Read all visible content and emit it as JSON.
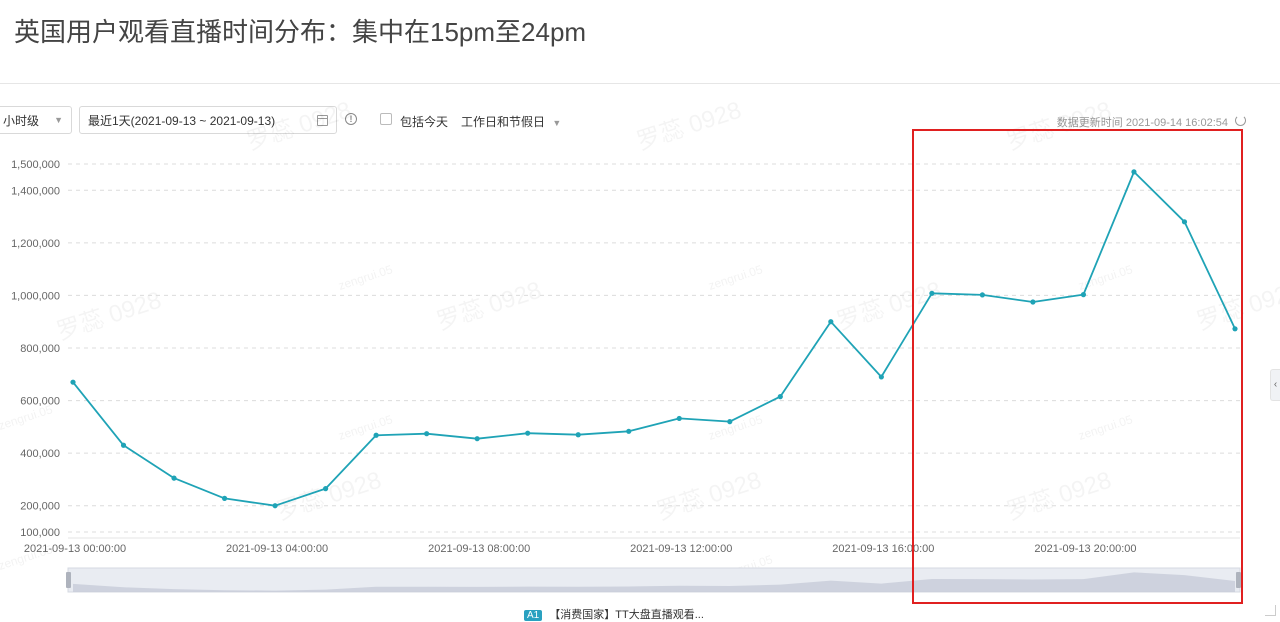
{
  "page": {
    "title": "英国用户观看直播时间分布：集中在15pm至24pm"
  },
  "toolbar": {
    "granularity": "小时级",
    "date_range": "最近1天(2021-09-13 ~ 2021-09-13)",
    "include_today_label": "包括今天",
    "day_type": "工作日和节假日",
    "update_time": "数据更新时间 2021-09-14 16:02:54"
  },
  "footer": {
    "badge": "A1",
    "label": "【消费国家】TT大盘直播观看..."
  },
  "colors": {
    "line": "#1fa3b6",
    "grid": "#dcdcdc",
    "highlight": "#e02020",
    "axis_text": "#666666"
  },
  "chart_data": {
    "type": "line",
    "x": [
      "2021-09-13 00:00:00",
      "2021-09-13 01:00:00",
      "2021-09-13 02:00:00",
      "2021-09-13 03:00:00",
      "2021-09-13 04:00:00",
      "2021-09-13 05:00:00",
      "2021-09-13 06:00:00",
      "2021-09-13 07:00:00",
      "2021-09-13 08:00:00",
      "2021-09-13 09:00:00",
      "2021-09-13 10:00:00",
      "2021-09-13 11:00:00",
      "2021-09-13 12:00:00",
      "2021-09-13 13:00:00",
      "2021-09-13 14:00:00",
      "2021-09-13 15:00:00",
      "2021-09-13 16:00:00",
      "2021-09-13 17:00:00",
      "2021-09-13 18:00:00",
      "2021-09-13 19:00:00",
      "2021-09-13 20:00:00",
      "2021-09-13 21:00:00",
      "2021-09-13 22:00:00",
      "2021-09-13 23:00:00"
    ],
    "series": [
      {
        "values": [
          670000,
          430000,
          305000,
          228000,
          200000,
          265000,
          468000,
          474000,
          455000,
          476000,
          470000,
          483000,
          532000,
          520000,
          615000,
          900000,
          690000,
          1008000,
          1002000,
          975000,
          1003000,
          1470000,
          1280000,
          873000
        ]
      }
    ],
    "x_tick_labels": [
      "2021-09-13 00:00:00",
      "2021-09-13 04:00:00",
      "2021-09-13 08:00:00",
      "2021-09-13 12:00:00",
      "2021-09-13 16:00:00",
      "2021-09-13 20:00:00"
    ],
    "x_tick_indices": [
      0,
      4,
      8,
      12,
      16,
      20
    ],
    "y_tick_values": [
      100000,
      200000,
      400000,
      600000,
      800000,
      1000000,
      1200000,
      1400000,
      1500000
    ],
    "y_tick_labels": [
      "100,000",
      "200,000",
      "400,000",
      "600,000",
      "800,000",
      "1,000,000",
      "1,200,000",
      "1,400,000",
      "1,500,000"
    ],
    "ylim": [
      100000,
      1500000
    ],
    "grid": true,
    "highlight_range": [
      16,
      23
    ],
    "watermarks": [
      "罗蕊 0928",
      "zengrui.05"
    ]
  }
}
